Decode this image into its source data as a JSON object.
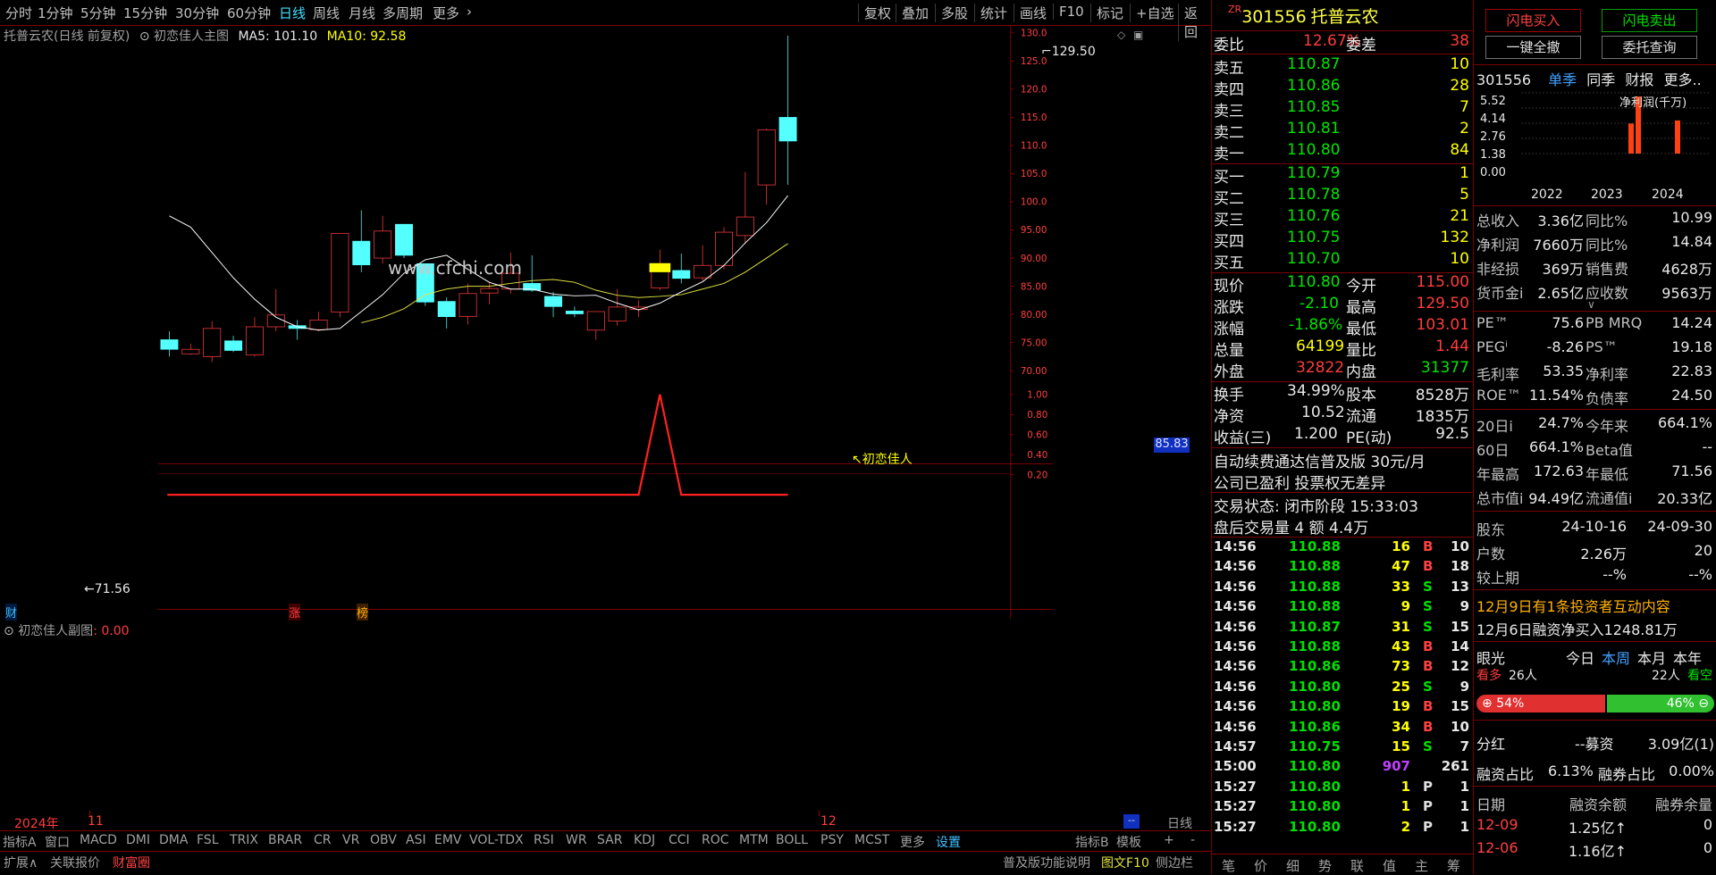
{
  "top_toolbar": {
    "left_items": [
      "分时",
      "1分钟",
      "5分钟",
      "15分钟",
      "30分钟",
      "60分钟",
      "日线",
      "周线",
      "月线",
      "多周期",
      "更多"
    ],
    "right_items": [
      "复权",
      "叠加",
      "多股",
      "统计",
      "画线",
      "F10",
      "标记",
      "+自选",
      "返回"
    ]
  },
  "chart_header": {
    "title": "托普云农(日线 前复权)",
    "indicator": "初恋佳人主图",
    "ma5_label": "MA5: 101.10",
    "ma10_label": "MA10: 92.58"
  },
  "watermark": "www.cfchi.com",
  "price_axis": [
    "130.0",
    "125.0",
    "120.0",
    "115.0",
    "110.0",
    "105.0",
    "100.0",
    "95.00",
    "90.00",
    "85.00",
    "80.00",
    "75.00",
    "70.00"
  ],
  "current_price_tag": "85.83",
  "high_mark": "129.50",
  "low_mark": "71.56",
  "signal_label": "初恋佳人",
  "bottom_markers": [
    "财",
    "涨",
    "榜"
  ],
  "sub_chart": {
    "title": "初恋佳人副图",
    "value": ": 0.00",
    "axis": [
      "1.00",
      "0.80",
      "0.60",
      "0.40",
      "0.20"
    ]
  },
  "date_axis": {
    "year": "2024年",
    "m1": "11",
    "m2": "12",
    "end": "日线"
  },
  "chart_data": {
    "type": "candlestick",
    "title": "托普云农(日线 前复权)",
    "ylim": [
      70,
      130
    ],
    "candles": [
      {
        "o": 75.5,
        "c": 73.8,
        "h": 77,
        "l": 72.5
      },
      {
        "o": 73.0,
        "c": 73.8,
        "h": 74.8,
        "l": 72.8
      },
      {
        "o": 72.5,
        "c": 77.5,
        "h": 78.8,
        "l": 71.56
      },
      {
        "o": 75.3,
        "c": 73.6,
        "h": 76.2,
        "l": 73.3
      },
      {
        "o": 72.8,
        "c": 77.8,
        "h": 79.5,
        "l": 72.5
      },
      {
        "o": 77.8,
        "c": 79.9,
        "h": 84.5,
        "l": 77.0
      },
      {
        "o": 78.0,
        "c": 77.5,
        "h": 79.0,
        "l": 75.5
      },
      {
        "o": 77.3,
        "c": 79.0,
        "h": 80.5,
        "l": 77.0
      },
      {
        "o": 80.4,
        "c": 94.4,
        "h": 94.4,
        "l": 79.5
      },
      {
        "o": 93.0,
        "c": 88.8,
        "h": 98.5,
        "l": 87.5
      },
      {
        "o": 90.0,
        "c": 94.8,
        "h": 97.5,
        "l": 89.0
      },
      {
        "o": 96.0,
        "c": 90.5,
        "h": 96.0,
        "l": 90.0
      },
      {
        "o": 89.0,
        "c": 82.2,
        "h": 89.0,
        "l": 81.5
      },
      {
        "o": 82.3,
        "c": 79.6,
        "h": 83.0,
        "l": 77.5
      },
      {
        "o": 79.6,
        "c": 83.7,
        "h": 85.5,
        "l": 78.2
      },
      {
        "o": 83.8,
        "c": 84.6,
        "h": 85.8,
        "l": 81.8
      },
      {
        "o": 84.5,
        "c": 87.3,
        "h": 91.0,
        "l": 83.7
      },
      {
        "o": 85.5,
        "c": 84.3,
        "h": 90.5,
        "l": 84.0
      },
      {
        "o": 83.2,
        "c": 81.4,
        "h": 84.0,
        "l": 79.5
      },
      {
        "o": 80.6,
        "c": 80.1,
        "h": 81.4,
        "l": 79.5
      },
      {
        "o": 77.2,
        "c": 80.5,
        "h": 80.5,
        "l": 75.5
      },
      {
        "o": 78.8,
        "c": 81.3,
        "h": 84.5,
        "l": 78.0
      },
      {
        "o": 80.9,
        "c": 81.3,
        "h": 82.5,
        "l": 79.5
      },
      {
        "o": 84.7,
        "c": 87.8,
        "h": 91.5,
        "l": 84.3
      },
      {
        "o": 87.8,
        "c": 86.4,
        "h": 90.8,
        "l": 85.5
      },
      {
        "o": 86.5,
        "c": 88.7,
        "h": 92.3,
        "l": 86.0
      },
      {
        "o": 88.7,
        "c": 94.6,
        "h": 95.5,
        "l": 88.0
      },
      {
        "o": 94.0,
        "c": 97.3,
        "h": 105.3,
        "l": 92.5
      },
      {
        "o": 103.0,
        "c": 112.8,
        "h": 113.0,
        "l": 99.5
      },
      {
        "o": 115.0,
        "c": 110.8,
        "h": 129.5,
        "l": 103.01
      }
    ],
    "ma5": [
      97.5,
      95.5,
      91.0,
      86.5,
      82.7,
      79.5,
      77.8,
      77.2,
      77.5,
      80.5,
      83.5,
      87.3,
      89.7,
      90.5,
      88.0,
      85.7,
      84.5,
      84.5,
      83.6,
      83.3,
      83.4,
      82.0,
      80.8,
      82.0,
      84.0,
      85.8,
      88.7,
      92.7,
      96.3,
      101.1
    ],
    "ma10": [
      null,
      null,
      null,
      null,
      null,
      null,
      null,
      null,
      null,
      78.5,
      79.5,
      81.0,
      83.5,
      84.5,
      85.0,
      85.0,
      85.5,
      86.0,
      86.2,
      85.7,
      84.3,
      83.4,
      83.0,
      83.2,
      83.5,
      84.5,
      85.5,
      87.5,
      90.0,
      92.58
    ],
    "signal": [
      0,
      0,
      0,
      0,
      0,
      0,
      0,
      0,
      0,
      0,
      0,
      0,
      0,
      0,
      0,
      0,
      0,
      0,
      0,
      0,
      0,
      0,
      0,
      1,
      0,
      0,
      0,
      0,
      0,
      0
    ]
  },
  "bottom_tabs": [
    "指标A",
    "窗口",
    "MACD",
    "DMI",
    "DMA",
    "FSL",
    "TRIX",
    "BRAR",
    "CR",
    "VR",
    "OBV",
    "ASI",
    "EMV",
    "VOL-TDX",
    "RSI",
    "WR",
    "SAR",
    "KDJ",
    "CCI",
    "ROC",
    "MTM",
    "BOLL",
    "PSY",
    "MCST",
    "更多",
    "设置"
  ],
  "bottom_right_tabs": [
    "指标B",
    "模板",
    "+",
    "-"
  ],
  "bottom_row2": [
    "扩展∧",
    "关联报价",
    "财富圈"
  ],
  "bottom_row2_right": [
    "普及版功能说明",
    "图文F10",
    "侧边栏"
  ],
  "stock": {
    "code": "301556",
    "name": "托普云农",
    "tag": "ZR"
  },
  "order_book": {
    "webi_label": "委比",
    "webi": "12.67%",
    "wecha_label": "委差",
    "wecha": "38",
    "asks": [
      {
        "label": "卖五",
        "price": "110.87",
        "vol": "10"
      },
      {
        "label": "卖四",
        "price": "110.86",
        "vol": "28"
      },
      {
        "label": "卖三",
        "price": "110.85",
        "vol": "7"
      },
      {
        "label": "卖二",
        "price": "110.81",
        "vol": "2"
      },
      {
        "label": "卖一",
        "price": "110.80",
        "vol": "84"
      }
    ],
    "bids": [
      {
        "label": "买一",
        "price": "110.79",
        "vol": "1"
      },
      {
        "label": "买二",
        "price": "110.78",
        "vol": "5"
      },
      {
        "label": "买三",
        "price": "110.76",
        "vol": "21"
      },
      {
        "label": "买四",
        "price": "110.75",
        "vol": "132"
      },
      {
        "label": "买五",
        "price": "110.70",
        "vol": "10"
      }
    ]
  },
  "quote": [
    [
      "现价",
      "110.80",
      "今开",
      "115.00"
    ],
    [
      "涨跌",
      "-2.10",
      "最高",
      "129.50"
    ],
    [
      "涨幅",
      "-1.86%",
      "最低",
      "103.01"
    ],
    [
      "总量",
      "64199",
      "量比",
      "1.44"
    ],
    [
      "外盘",
      "32822",
      "内盘",
      "31377"
    ]
  ],
  "stats": [
    [
      "换手",
      "34.99%",
      "股本",
      "8528万"
    ],
    [
      "净资",
      "10.52",
      "流通",
      "1835万"
    ],
    [
      "收益(三)",
      "1.200",
      "PE(动)",
      "92.5"
    ]
  ],
  "promo1": "自动续费通达信普及版  30元/月",
  "promo2": "公司已盈利 投票权无差异",
  "trade_status": {
    "label": "交易状态: 闭市阶段",
    "time": "15:33:03"
  },
  "after_hours": "盘后交易量 4 额 4.4万",
  "trades": [
    [
      "14:56",
      "110.88",
      "16",
      "B",
      "10"
    ],
    [
      "14:56",
      "110.88",
      "47",
      "B",
      "18"
    ],
    [
      "14:56",
      "110.88",
      "33",
      "S",
      "13"
    ],
    [
      "14:56",
      "110.88",
      "9",
      "S",
      "9"
    ],
    [
      "14:56",
      "110.87",
      "31",
      "S",
      "15"
    ],
    [
      "14:56",
      "110.88",
      "43",
      "B",
      "14"
    ],
    [
      "14:56",
      "110.86",
      "73",
      "B",
      "12"
    ],
    [
      "14:56",
      "110.80",
      "25",
      "S",
      "9"
    ],
    [
      "14:56",
      "110.80",
      "19",
      "B",
      "15"
    ],
    [
      "14:56",
      "110.86",
      "34",
      "B",
      "10"
    ],
    [
      "14:57",
      "110.75",
      "15",
      "S",
      "7"
    ],
    [
      "15:00",
      "110.80",
      "907",
      "",
      "261"
    ],
    [
      "15:27",
      "110.80",
      "1",
      "P",
      "1"
    ],
    [
      "15:27",
      "110.80",
      "1",
      "P",
      "1"
    ],
    [
      "15:27",
      "110.80",
      "2",
      "P",
      "1"
    ]
  ],
  "mid_tabs": [
    "笔",
    "价",
    "细",
    "势",
    "联",
    "值",
    "主",
    "筹"
  ],
  "right_buttons": {
    "flash_buy": "闪电买入",
    "flash_sell": "闪电卖出",
    "cancel_all": "一键全撤",
    "query": "委托查询"
  },
  "fin_tabs": {
    "code": "301556",
    "t1": "单季",
    "t2": "同季",
    "t3": "财报",
    "t4": "更多.."
  },
  "fin_chart": {
    "title": "净利润(千万)",
    "yaxis": [
      "5.52",
      "4.14",
      "2.76",
      "1.38",
      "0.00"
    ],
    "years": [
      "2022",
      "2023",
      "2024"
    ],
    "bars": [
      2.9,
      5.52,
      3.2
    ]
  },
  "fin_rows": [
    [
      "总收入",
      "3.36亿",
      "同比%",
      "10.99"
    ],
    [
      "净利润",
      "7660万",
      "同比%",
      "14.84"
    ],
    [
      "非经损",
      "369万",
      "销售费",
      "4628万"
    ],
    [
      "货币金i",
      "2.65亿",
      "应收数",
      "9563万"
    ]
  ],
  "val_rows": [
    [
      "PE™",
      "75.6",
      "PB MRQ",
      "14.24"
    ],
    [
      "PEGⁱ",
      "-8.26",
      "PS™",
      "19.18"
    ],
    [
      "毛利率",
      "53.35",
      "净利率",
      "22.83"
    ],
    [
      "ROE™",
      "11.54%",
      "负债率",
      "24.50"
    ]
  ],
  "perf_rows": [
    [
      "20日i",
      "24.7%",
      "今年来",
      "664.1%"
    ],
    [
      "60日",
      "664.1%",
      "Beta值",
      "--"
    ],
    [
      "年最高",
      "172.63",
      "年最低",
      "71.56"
    ],
    [
      "总市值i",
      "94.49亿",
      "流通值i",
      "20.33亿"
    ]
  ],
  "holder_rows": [
    [
      "股东",
      "24-10-16",
      "24-09-30"
    ],
    [
      "户数",
      "2.26万",
      "20"
    ],
    [
      "较上期",
      "--%",
      "--%"
    ]
  ],
  "news1": "12月9日有1条投资者互动内容",
  "news2": "12月6日融资净买入1248.81万",
  "eye": {
    "label": "眼光",
    "t1": "今日",
    "t2": "本周",
    "t3": "本月",
    "t4": "本年",
    "bull": "看多",
    "bull_n": "26人",
    "bear_n": "22人",
    "bear": "看空",
    "bull_pct": "54%",
    "bear_pct": "46%"
  },
  "dividend": {
    "label": "分红",
    "v1": "--募资",
    "v2": "3.09亿(1)"
  },
  "margin": {
    "l1": "融资占比",
    "v1": "6.13%",
    "l2": "融券占比",
    "v2": "0.00%"
  },
  "margin_table": {
    "headers": [
      "日期",
      "融资余额",
      "融券余量"
    ],
    "rows": [
      [
        "12-09",
        "1.25亿↑",
        "0"
      ],
      [
        "12-06",
        "1.16亿↑",
        "0"
      ]
    ]
  },
  "colors": {
    "up": "#ff3c3c",
    "down": "#54ffff",
    "ma5": "#ffffff",
    "ma10": "#e0e040",
    "border": "#800000"
  }
}
